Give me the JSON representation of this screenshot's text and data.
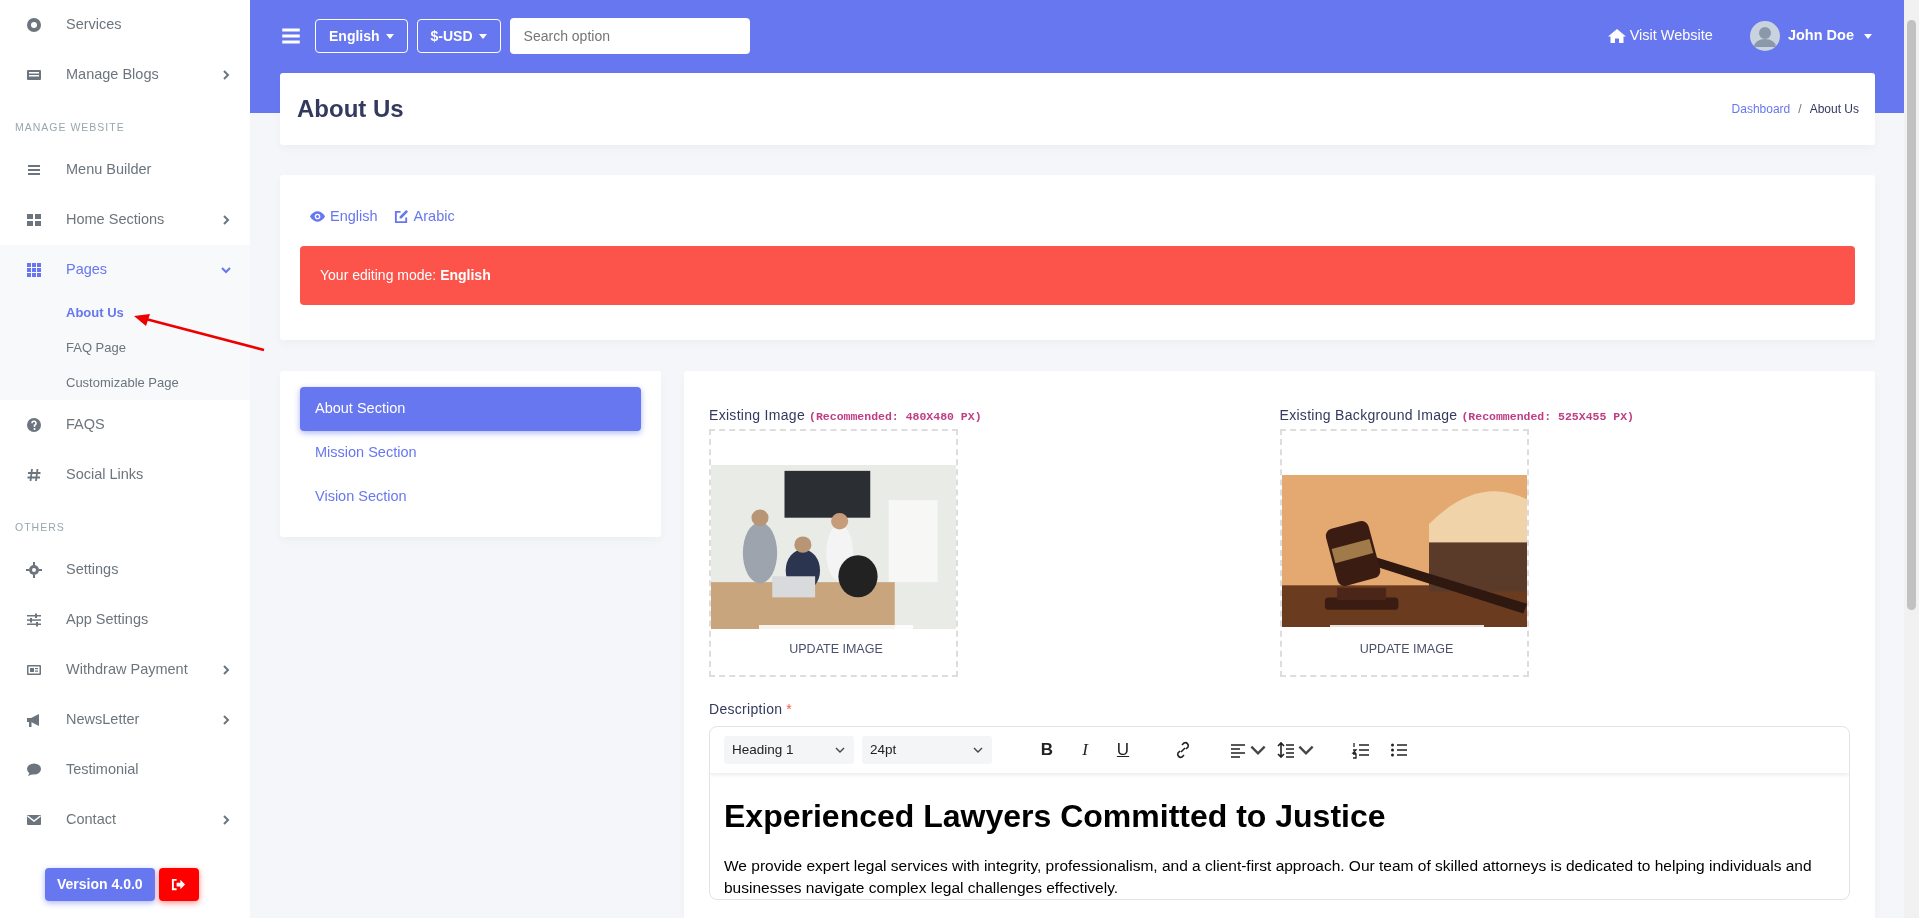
{
  "sidebar": {
    "items": [
      {
        "kind": "link",
        "label": "Services"
      },
      {
        "kind": "link",
        "label": "Manage Blogs",
        "expanded": false
      },
      {
        "kind": "heading",
        "label": "MANAGE WEBSITE"
      },
      {
        "kind": "link",
        "label": "Menu Builder"
      },
      {
        "kind": "link",
        "label": "Home Sections",
        "expanded": false
      },
      {
        "kind": "link",
        "label": "Pages",
        "expanded": true,
        "children": [
          {
            "label": "About Us",
            "selected": true
          },
          {
            "label": "FAQ Page",
            "selected": false
          },
          {
            "label": "Customizable Page",
            "selected": false
          }
        ]
      },
      {
        "kind": "link",
        "label": "FAQS"
      },
      {
        "kind": "link",
        "label": "Social Links"
      },
      {
        "kind": "heading",
        "label": "OTHERS"
      },
      {
        "kind": "link",
        "label": "Settings"
      },
      {
        "kind": "link",
        "label": "App Settings"
      },
      {
        "kind": "link",
        "label": "Withdraw Payment",
        "expanded": false
      },
      {
        "kind": "link",
        "label": "NewsLetter",
        "expanded": false
      },
      {
        "kind": "link",
        "label": "Testimonial"
      },
      {
        "kind": "link",
        "label": "Contact",
        "expanded": false
      }
    ],
    "version_button": "Version 4.0.0"
  },
  "topbar": {
    "language": "English",
    "currency": "$-USD",
    "search": {
      "placeholder": "Search option"
    },
    "visit_link": "Visit Website",
    "user": "John Doe"
  },
  "page_header": {
    "title": "About Us",
    "separator": "/",
    "breadcrumb": [
      {
        "label": "Dashboard",
        "active": false
      },
      {
        "label": "About Us",
        "active": true
      }
    ]
  },
  "language_tabs": [
    {
      "label": "English",
      "kind": "view"
    },
    {
      "label": "Arabic",
      "kind": "edit"
    }
  ],
  "alert": "Your editing mode: **English**",
  "section_tabs": [
    {
      "label": "About Section",
      "selected": true
    },
    {
      "label": "Mission Section",
      "selected": false
    },
    {
      "label": "Vision Section",
      "selected": false
    }
  ],
  "images": [
    {
      "label": "Existing Image",
      "hint": "(Recommended: 480X480 PX)",
      "button": "UPDATE IMAGE",
      "kind": "picture"
    },
    {
      "label": "Existing Background Image",
      "hint": "(Recommended: 525X455 PX)",
      "button": "UPDATE IMAGE",
      "kind": "picture"
    }
  ],
  "editor": {
    "label": "Description",
    "required_mark": "*",
    "block_format": "Heading 1",
    "font_size": "24pt",
    "format_buttons": [
      {
        "label": "B",
        "kind": "bold"
      },
      {
        "label": "I",
        "kind": "italic"
      },
      {
        "label": "U",
        "kind": "underline"
      }
    ],
    "heading": "Experienced Lawyers Committed to Justice",
    "paragraph": "We provide expert legal services with integrity, professionalism, and a client-first approach. Our team of skilled attorneys is dedicated to helping individuals and businesses navigate complex legal challenges effectively."
  }
}
